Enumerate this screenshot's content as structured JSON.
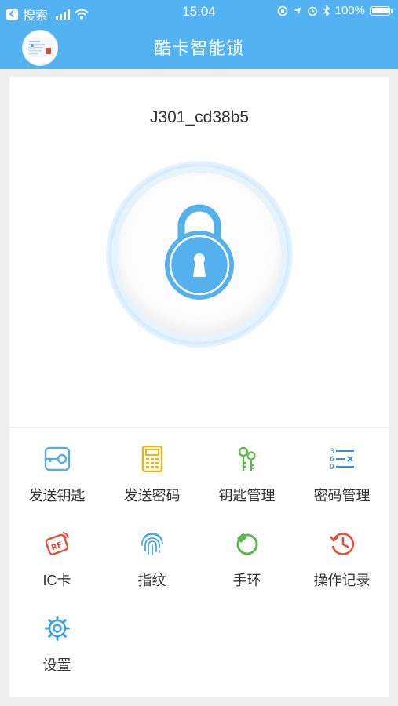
{
  "status_bar": {
    "back_app": "搜索",
    "time": "15:04",
    "battery": "100%"
  },
  "header": {
    "title": "酷卡智能锁"
  },
  "device": {
    "name": "J301_cd38b5"
  },
  "colors": {
    "header": "#52b2f2",
    "lock_blue": "#55b0ee",
    "send_key": "#52aef0",
    "send_password": "#f2b30e",
    "key_manage": "#5bb84a",
    "password_manage": "#3a8fd6",
    "ic_card": "#ea4c36",
    "fingerprint": "#46a6ea",
    "bracelet": "#5bb84a",
    "records": "#ea4c36",
    "settings": "#3aa0e4"
  },
  "menu": [
    {
      "label": "发送钥匙",
      "icon": "send-key-icon"
    },
    {
      "label": "发送密码",
      "icon": "calculator-icon"
    },
    {
      "label": "钥匙管理",
      "icon": "keys-icon"
    },
    {
      "label": "密码管理",
      "icon": "password-list-icon"
    },
    {
      "label": "IC卡",
      "icon": "rf-card-icon"
    },
    {
      "label": "指纹",
      "icon": "fingerprint-icon"
    },
    {
      "label": "手环",
      "icon": "bracelet-icon"
    },
    {
      "label": "操作记录",
      "icon": "history-icon"
    },
    {
      "label": "设置",
      "icon": "gear-icon"
    }
  ]
}
